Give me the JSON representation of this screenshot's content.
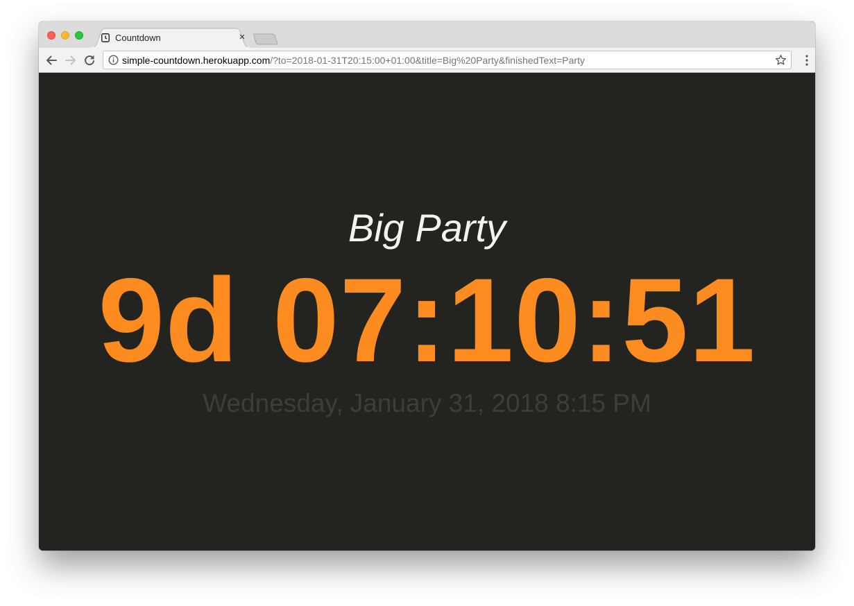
{
  "browser": {
    "tab": {
      "title": "Countdown",
      "favicon": "clock-icon",
      "close_glyph": "×"
    },
    "address_bar": {
      "host": "simple-countdown.herokuapp.com",
      "path": "/?to=2018-01-31T20:15:00+01:00&title=Big%20Party&finishedText=Party"
    },
    "icons": [
      "back-arrow-icon",
      "forward-arrow-icon",
      "reload-icon",
      "info-icon",
      "star-icon",
      "menu-icon"
    ]
  },
  "countdown": {
    "title": "Big Party",
    "timer": "9d 07:10:51",
    "target_date": "Wednesday, January 31, 2018 8:15 PM"
  },
  "colors": {
    "page_background": "#232320",
    "title": "#f4f4ef",
    "timer": "#fc8c1f",
    "date": "#3e3e38"
  }
}
